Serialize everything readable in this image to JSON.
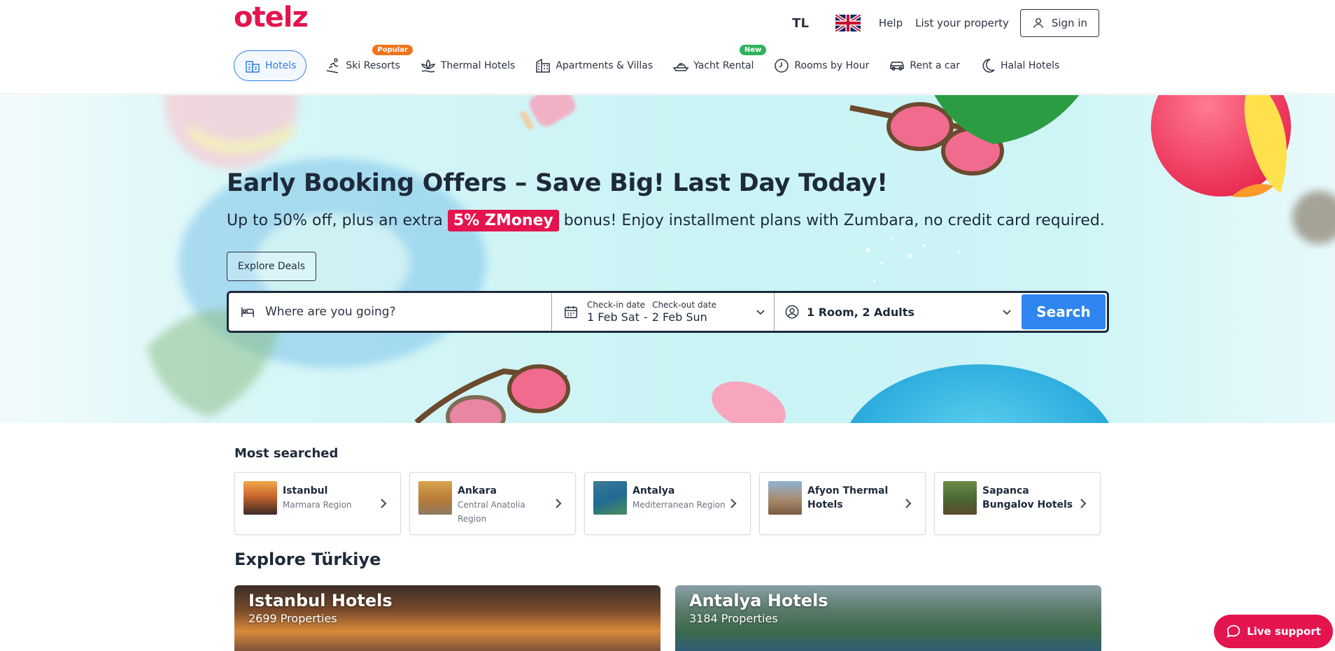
{
  "header": {
    "logo": "otelz",
    "currency": "TL",
    "language_flag": "uk-flag-icon",
    "help": "Help",
    "list_property": "List your property",
    "sign_in": "Sign in"
  },
  "nav": [
    {
      "label": "Hotels",
      "icon": "hotel-icon",
      "active": true
    },
    {
      "label": "Ski Resorts",
      "icon": "ski-icon",
      "badge": "Popular"
    },
    {
      "label": "Thermal Hotels",
      "icon": "lotus-icon"
    },
    {
      "label": "Apartments & Villas",
      "icon": "building-icon"
    },
    {
      "label": "Yacht Rental",
      "icon": "yacht-icon",
      "badge": "New"
    },
    {
      "label": "Rooms by Hour",
      "icon": "clock-icon"
    },
    {
      "label": "Rent a car",
      "icon": "car-icon"
    },
    {
      "label": "Halal Hotels",
      "icon": "crescent-icon"
    }
  ],
  "hero": {
    "title": "Early Booking Offers – Save Big! Last Day Today!",
    "sub_before": "Up to 50% off, plus an extra",
    "sub_highlight": "5% ZMoney",
    "sub_after": "bonus! Enjoy installment plans with Zumbara, no credit card required.",
    "explore_button": "Explore Deals"
  },
  "search": {
    "destination_placeholder": "Where are you going?",
    "checkin_label": "Check-in date",
    "checkout_label": "Check-out date",
    "checkin_value": "1 Feb Sat",
    "date_separator": "-",
    "checkout_value": "2 Feb Sun",
    "guests": "1 Room, 2 Adults",
    "button": "Search"
  },
  "most_searched": {
    "title": "Most searched",
    "items": [
      {
        "name": "Istanbul",
        "region": "Marmara Region"
      },
      {
        "name": "Ankara",
        "region": "Central Anatolia Region"
      },
      {
        "name": "Antalya",
        "region": "Mediterranean Region"
      },
      {
        "name": "Afyon Thermal Hotels",
        "region": ""
      },
      {
        "name": "Sapanca Bungalov Hotels",
        "region": ""
      }
    ]
  },
  "explore": {
    "title": "Explore Türkiye",
    "cards": [
      {
        "name": "Istanbul Hotels",
        "count": "2699 Properties"
      },
      {
        "name": "Antalya Hotels",
        "count": "3184 Properties"
      }
    ]
  },
  "live_support": "Live support",
  "colors": {
    "brand": "#e4144e",
    "accent_blue": "#2f86f0",
    "text": "#1e2a3a"
  }
}
